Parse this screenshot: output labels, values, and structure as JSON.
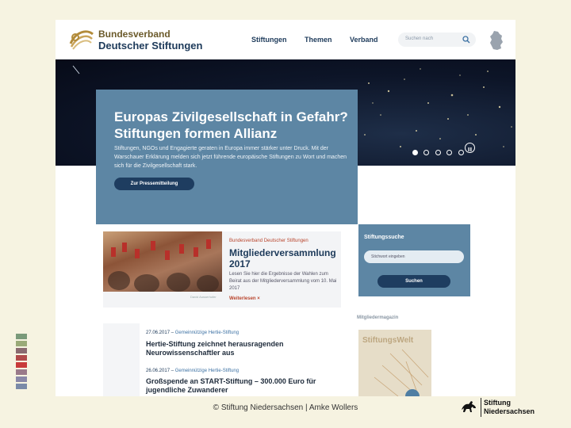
{
  "header": {
    "logo_line1": "Bundesverband",
    "logo_line2": "Deutscher Stiftungen",
    "nav": [
      "Stiftungen",
      "Themen",
      "Verband"
    ],
    "search_placeholder": "Suchen nach"
  },
  "hero": {
    "slides": 5,
    "active_slide": 1
  },
  "feature": {
    "title": "Europas Zivilgesellschaft in Gefahr? Stiftungen formen Allianz",
    "text": "Stiftungen, NGOs und Engagierte geraten in Europa immer stärker unter Druck. Mit der Warschauer Erklärung melden sich jetzt führende europäische Stiftungen zu Wort und machen sich für die Zivilgesellschaft stark.",
    "button": "Zur Pressemitteilung"
  },
  "member_meeting": {
    "kicker": "Bundesverband Deutscher Stiftungen",
    "title": "Mitgliederversammlung 2017",
    "text": "Lesen Sie hier die Ergebnisse der Wahlen zum Beirat aus der Mitgliederversammlung vom 10. Mai 2017",
    "link": "Weiterlesen",
    "photo_caption": "David Ausserhofer"
  },
  "foundation_search": {
    "title": "Stiftungssuche",
    "placeholder": "Stichwort eingeben",
    "button": "Suchen"
  },
  "news": [
    {
      "date": "27.06.2017",
      "topic": "Gemeinnützige Hertie-Stiftung",
      "title": "Hertie-Stiftung zeichnet herausragenden Neurowissenschaftler aus"
    },
    {
      "date": "26.06.2017",
      "topic": "Gemeinnützige Hertie-Stiftung",
      "title": "Großspende an START-Stiftung – 300.000 Euro für jugendliche Zuwanderer"
    }
  ],
  "magazine": {
    "label": "Mitgliedermagazin",
    "cover_title": "StiftungsWelt"
  },
  "slide": {
    "credit": "© Stiftung Niedersachsen | Amke Wollers",
    "logo_line1": "Stiftung",
    "logo_line2": "Niedersachsen",
    "swatch_colors": [
      "#7a9a7a",
      "#9aaa78",
      "#8a6a70",
      "#b04a4a",
      "#c83a3a",
      "#9a7a8a",
      "#8a88a8",
      "#7a8aa8"
    ]
  },
  "colors": {
    "accent_blue": "#5d86a4",
    "navy": "#1e3d60",
    "link_red": "#b9462e",
    "slide_bg": "#f6f3e1"
  }
}
